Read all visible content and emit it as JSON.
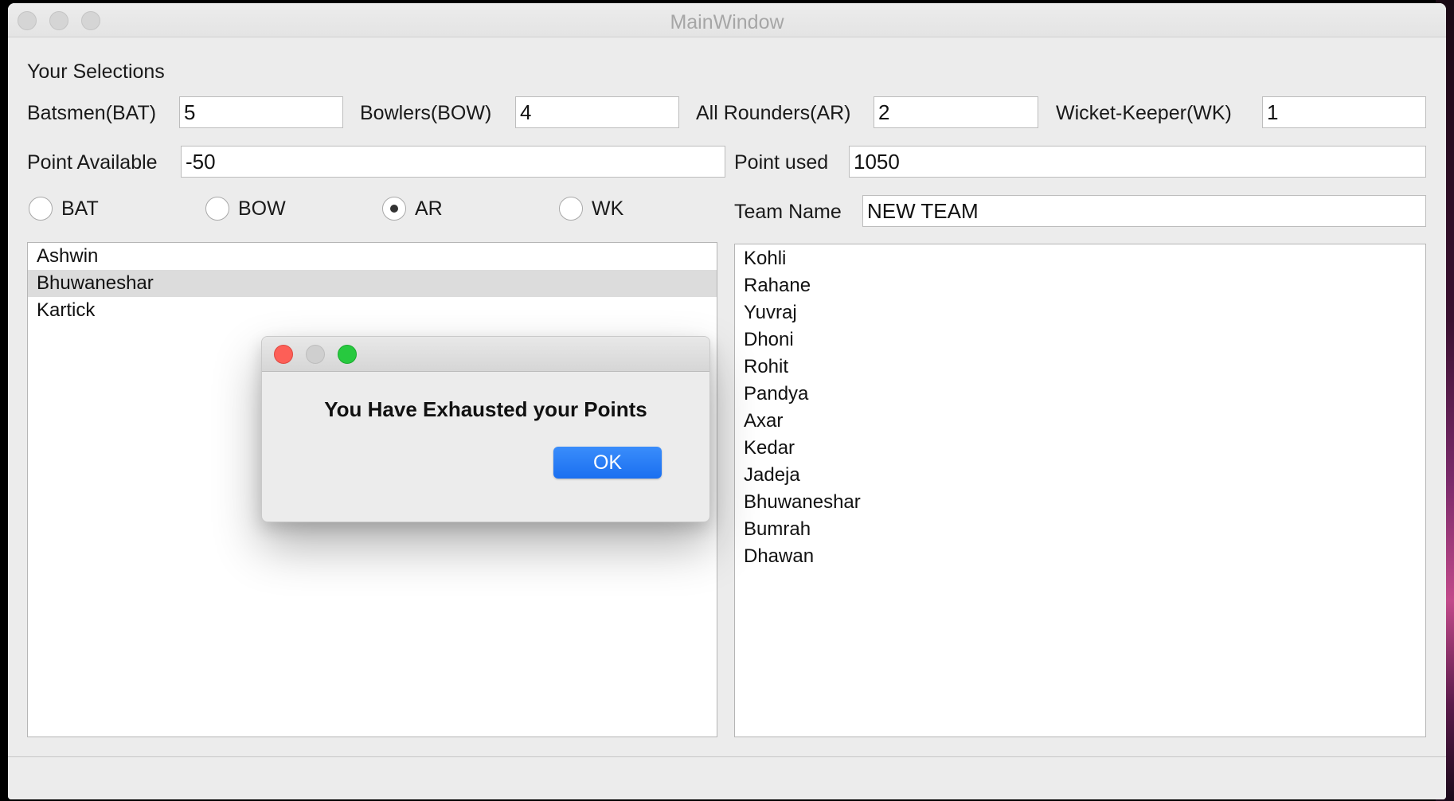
{
  "window": {
    "title": "MainWindow"
  },
  "selections": {
    "heading": "Your Selections",
    "batsmen_label": "Batsmen(BAT)",
    "batsmen_value": "5",
    "bowlers_label": "Bowlers(BOW)",
    "bowlers_value": "4",
    "allrounders_label": "All Rounders(AR)",
    "allrounders_value": "2",
    "wicketkeeper_label": "Wicket-Keeper(WK)",
    "wicketkeeper_value": "1"
  },
  "points": {
    "available_label": "Point Available",
    "available_value": "-50",
    "used_label": "Point used",
    "used_value": "1050"
  },
  "roles": {
    "options": [
      "BAT",
      "BOW",
      "AR",
      "WK"
    ],
    "selected": "AR"
  },
  "team": {
    "name_label": "Team Name",
    "name_value": "NEW TEAM"
  },
  "available_players": {
    "items": [
      "Ashwin",
      "Bhuwaneshar",
      "Kartick"
    ],
    "selected": "Bhuwaneshar"
  },
  "team_players": {
    "items": [
      "Kohli",
      "Rahane",
      "Yuvraj",
      "Dhoni",
      "Rohit",
      "Pandya",
      "Axar",
      "Kedar",
      "Jadeja",
      "Bhuwaneshar",
      "Bumrah",
      "Dhawan"
    ]
  },
  "dialog": {
    "message": "You Have Exhausted your Points",
    "ok_label": "OK"
  },
  "colors": {
    "window_bg": "#ececec",
    "selection_bg": "#dcdcdc",
    "ok_button": "#1a6ff0",
    "close_light": "#fd5f57",
    "zoom_light": "#27c93f"
  }
}
